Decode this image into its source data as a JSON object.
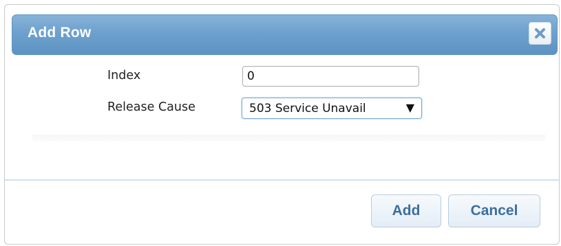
{
  "dialog": {
    "title": "Add Row",
    "close_icon": "close-x-icon"
  },
  "form": {
    "index": {
      "label": "Index",
      "value": "0"
    },
    "release_cause": {
      "label": "Release Cause",
      "selected": "503 Service Unavail",
      "arrow": "▼"
    }
  },
  "buttons": {
    "add_label": "Add",
    "cancel_label": "Cancel"
  },
  "colors": {
    "titlebar": "#6ea1cd",
    "button_text": "#3d6f9c",
    "divider": "#cfe0ef"
  }
}
